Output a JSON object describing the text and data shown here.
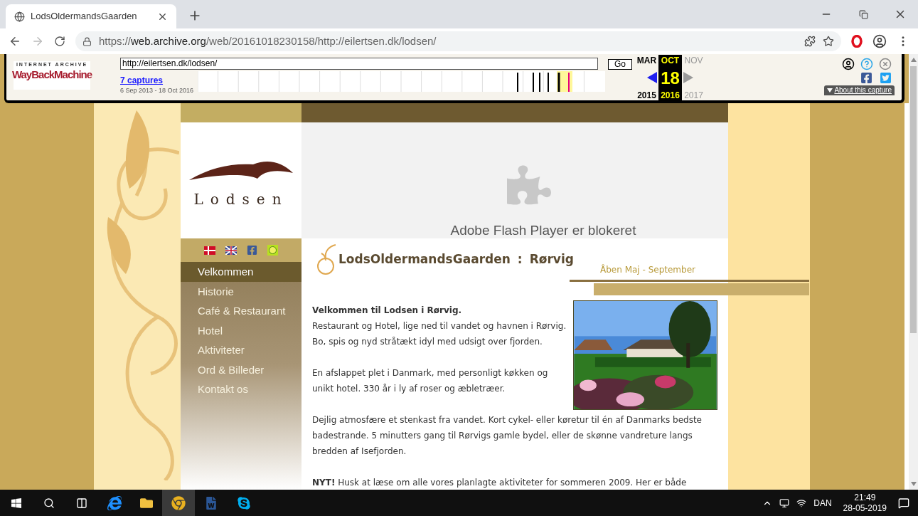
{
  "browser": {
    "tab": {
      "title": "LodsOldermandsGaarden",
      "selected": true
    },
    "url": {
      "scheme": "https://",
      "host": "web.archive.org",
      "path": "/web/20161018230158/http://eilertsen.dk/lodsen/"
    }
  },
  "wayback": {
    "logo_top": "INTERNET ARCHIVE",
    "logo_word": "WayBackMachine",
    "url_value": "http://eilertsen.dk/lodsen/",
    "go": "Go",
    "captures": "7 captures",
    "range": "6 Sep 2013 - 18 Oct 2016",
    "months": [
      {
        "month": "MAR",
        "year": "2015",
        "selected": false,
        "kind": "prev"
      },
      {
        "month": "OCT",
        "day": "18",
        "year": "2016",
        "selected": true,
        "kind": "current"
      },
      {
        "month": "NOV",
        "year": "2017",
        "selected": false,
        "kind": "next"
      }
    ],
    "about": "About this capture"
  },
  "site": {
    "logo_text": "Lodsen",
    "flash_message": "Adobe Flash Player er blokeret",
    "nav": [
      {
        "label": "Velkommen",
        "selected": true
      },
      {
        "label": "Historie",
        "selected": false
      },
      {
        "label": "Café & Restaurant",
        "selected": false
      },
      {
        "label": "Hotel",
        "selected": false
      },
      {
        "label": "Aktiviteter",
        "selected": false
      },
      {
        "label": "Ord & Billeder",
        "selected": false
      },
      {
        "label": "Kontakt os",
        "selected": false
      }
    ],
    "brand": "LodsOldermandsGaarden",
    "brand_sep": ":",
    "town": "Rørvig",
    "season": "Åben Maj - September",
    "heading": "Velkommen til Lodsen i Rørvig.",
    "paragraphs": [
      {
        "lines": [
          "Restaurant og Hotel, lige ned til vandet og havnen i Rørvig.",
          "Bo, spis og nyd stråtækt idyl med udsigt over fjorden."
        ]
      },
      {
        "lines": [
          "En afslappet plet i Danmark, med personligt køkken og",
          "unikt hotel. 330 år i ly af roser og æbletræer."
        ]
      },
      {
        "lines": [
          "Dejlig atmosfære et stenkast fra vandet. Kort cykel- eller køretur til én af Danmarks bedste",
          "badestrande. 5 minutters gang til Rørvigs gamle bydel, eller de skønne vandreture langs",
          "bredden af Isefjorden."
        ]
      },
      {
        "lines": [
          "**NYT!** Husk at læse om alle vores planlagte aktiviteter for sommeren 2009. Her er både"
        ]
      }
    ]
  },
  "taskbar": {
    "language": "DAN",
    "time": "21:49",
    "date": "28-05-2019"
  }
}
